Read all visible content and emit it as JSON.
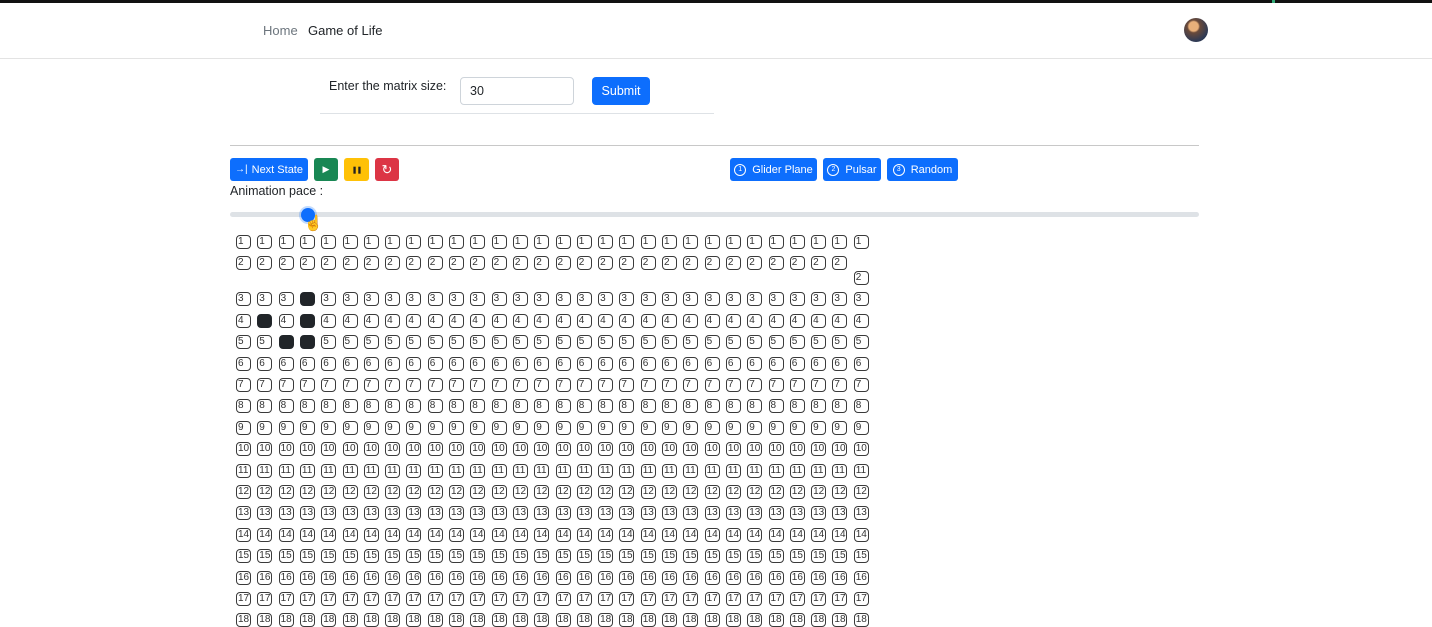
{
  "nav": {
    "home": "Home",
    "current": "Game of Life"
  },
  "form": {
    "label": "Enter the matrix size:",
    "value": "30",
    "submit": "Submit"
  },
  "controls": {
    "next_state": "Next State",
    "play_icon": "▶",
    "pause_icon": "❚❚",
    "reset_icon": "↻",
    "next_icon": "→|"
  },
  "presets": {
    "glider": {
      "num": "1",
      "label": "Glider Plane"
    },
    "pulsar": {
      "num": "2",
      "label": "Pulsar"
    },
    "random": {
      "num": "3",
      "label": "Random"
    }
  },
  "pace": {
    "label": "Animation pace :",
    "value_fraction": 0.08
  },
  "board": {
    "columns": 30,
    "visible_rows": [
      1,
      2,
      3,
      4,
      5,
      6,
      7,
      8,
      9,
      10,
      11,
      12,
      13,
      14,
      15,
      16,
      17,
      18
    ],
    "alive_cells": [
      [
        3,
        4
      ],
      [
        4,
        2
      ],
      [
        4,
        4
      ],
      [
        5,
        3
      ],
      [
        5,
        4
      ]
    ],
    "colors": {
      "alive": "#212529",
      "border": "#3a3a3a"
    }
  },
  "colors": {
    "primary": "#0d6efd",
    "success": "#198754",
    "warning": "#ffc107",
    "danger": "#dc3545"
  }
}
